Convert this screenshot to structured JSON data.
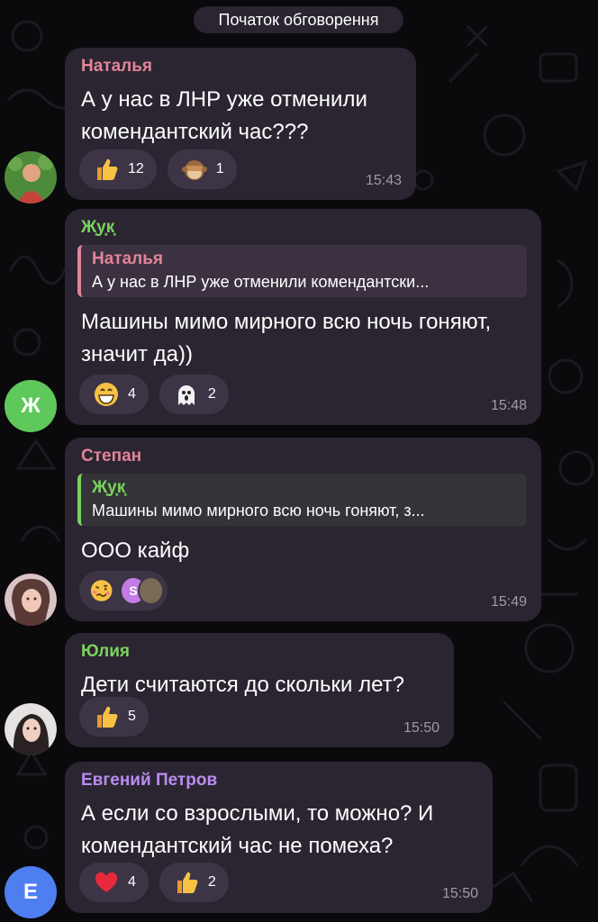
{
  "header": {
    "discussion_start": "Початок обговорення"
  },
  "messages": [
    {
      "sender": "Наталья",
      "sender_color": "#e2849a",
      "text": "А у нас в ЛНР уже отменили комендантский час???",
      "time": "15:43",
      "reactions": [
        {
          "emoji": "thumbs-up",
          "count": "12"
        },
        {
          "emoji": "see-no-evil-monkey",
          "count": "1"
        }
      ]
    },
    {
      "sender": "Ж͙у͙к͙",
      "sender_color": "#7ad35c",
      "reply_to": {
        "name": "Наталья",
        "text": "А у нас в ЛНР уже отменили комендантски...",
        "color": "#e2849a"
      },
      "text": "Машины мимо мирного всю ночь гоняют, значит да))",
      "time": "15:48",
      "avatar_letter": "Ж",
      "avatar_color": "#5ec85a",
      "reactions": [
        {
          "emoji": "grinning-face",
          "count": "4"
        },
        {
          "emoji": "ghost",
          "count": "2"
        }
      ]
    },
    {
      "sender": "Степан",
      "sender_color": "#e2849a",
      "reply_to": {
        "name": "Ж͙у͙к͙",
        "text": "Машины мимо мирного всю ночь гоняют, з...",
        "color": "#7ad35c"
      },
      "text": "ООО кайф",
      "time": "15:49",
      "reactions": [
        {
          "emoji": "woozy-face",
          "reactors": [
            "S"
          ]
        }
      ]
    },
    {
      "sender": "Юлия",
      "sender_color": "#7ad35c",
      "text": "Дети считаются до скольки лет?",
      "time": "15:50",
      "reactions": [
        {
          "emoji": "thumbs-up",
          "count": "5"
        }
      ]
    },
    {
      "sender": "Евгений Петров",
      "sender_color": "#b98cf0",
      "text": "А если со взрослыми, то можно? И комендантский час не помеха?",
      "time": "15:50",
      "avatar_letter": "Е",
      "avatar_color": "#4f7ef0",
      "reactions": [
        {
          "emoji": "red-heart",
          "count": "4"
        },
        {
          "emoji": "thumbs-up",
          "count": "2"
        }
      ]
    }
  ]
}
